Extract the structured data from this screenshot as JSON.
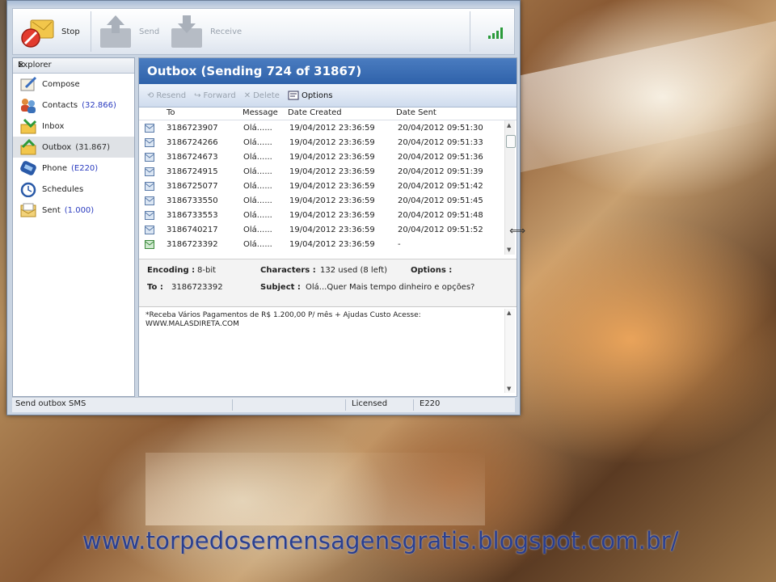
{
  "toolbar": {
    "stop_label": "Stop",
    "send_label": "Send",
    "receive_label": "Receive"
  },
  "explorer": {
    "title": "Explorer",
    "close_label": "×",
    "items": [
      {
        "label": "Compose",
        "count": ""
      },
      {
        "label": "Contacts",
        "count": "(32.866)"
      },
      {
        "label": "Inbox",
        "count": ""
      },
      {
        "label": "Outbox",
        "count": "(31.867)"
      },
      {
        "label": "Phone",
        "count": "(E220)"
      },
      {
        "label": "Schedules",
        "count": ""
      },
      {
        "label": "Sent",
        "count": "(1.000)"
      }
    ]
  },
  "main": {
    "title": "Outbox (Sending 724 of 31867)",
    "toolbar": {
      "resend": "Resend",
      "forward": "Forward",
      "delete": "Delete",
      "options": "Options"
    },
    "columns": {
      "to": "To",
      "message": "Message",
      "date_created": "Date Created",
      "date_sent": "Date Sent"
    },
    "rows": [
      {
        "to": "3186723907",
        "message": "Olá......",
        "created": "19/04/2012 23:36:59",
        "sent": "20/04/2012 09:51:30"
      },
      {
        "to": "3186724266",
        "message": "Olá......",
        "created": "19/04/2012 23:36:59",
        "sent": "20/04/2012 09:51:33"
      },
      {
        "to": "3186724673",
        "message": "Olá......",
        "created": "19/04/2012 23:36:59",
        "sent": "20/04/2012 09:51:36"
      },
      {
        "to": "3186724915",
        "message": "Olá......",
        "created": "19/04/2012 23:36:59",
        "sent": "20/04/2012 09:51:39"
      },
      {
        "to": "3186725077",
        "message": "Olá......",
        "created": "19/04/2012 23:36:59",
        "sent": "20/04/2012 09:51:42"
      },
      {
        "to": "3186733550",
        "message": "Olá......",
        "created": "19/04/2012 23:36:59",
        "sent": "20/04/2012 09:51:45"
      },
      {
        "to": "3186733553",
        "message": "Olá......",
        "created": "19/04/2012 23:36:59",
        "sent": "20/04/2012 09:51:48"
      },
      {
        "to": "3186740217",
        "message": "Olá......",
        "created": "19/04/2012 23:36:59",
        "sent": "20/04/2012 09:51:52"
      },
      {
        "to": "3186723392",
        "message": "Olá......",
        "created": "19/04/2012 23:36:59",
        "sent": "-"
      }
    ],
    "details": {
      "encoding_label": "Encoding :",
      "encoding_value": "8-bit",
      "characters_label": "Characters :",
      "characters_value": "132 used (8 left)",
      "options_label": "Options :",
      "to_label": "To :",
      "to_value": "3186723392",
      "subject_label": "Subject :",
      "subject_value": "Olá...Quer Mais tempo dinheiro e opções?"
    },
    "body_text": "*Receba Vários Pagamentos de R$ 1.200,00 P/ mês + Ajudas Custo Acesse: WWW.MALASDIRETA.COM"
  },
  "status": {
    "left": "Send outbox SMS",
    "license": "Licensed",
    "device": "E220"
  },
  "website": "www.torpedosemensagensgratis.blogspot.com.br/"
}
